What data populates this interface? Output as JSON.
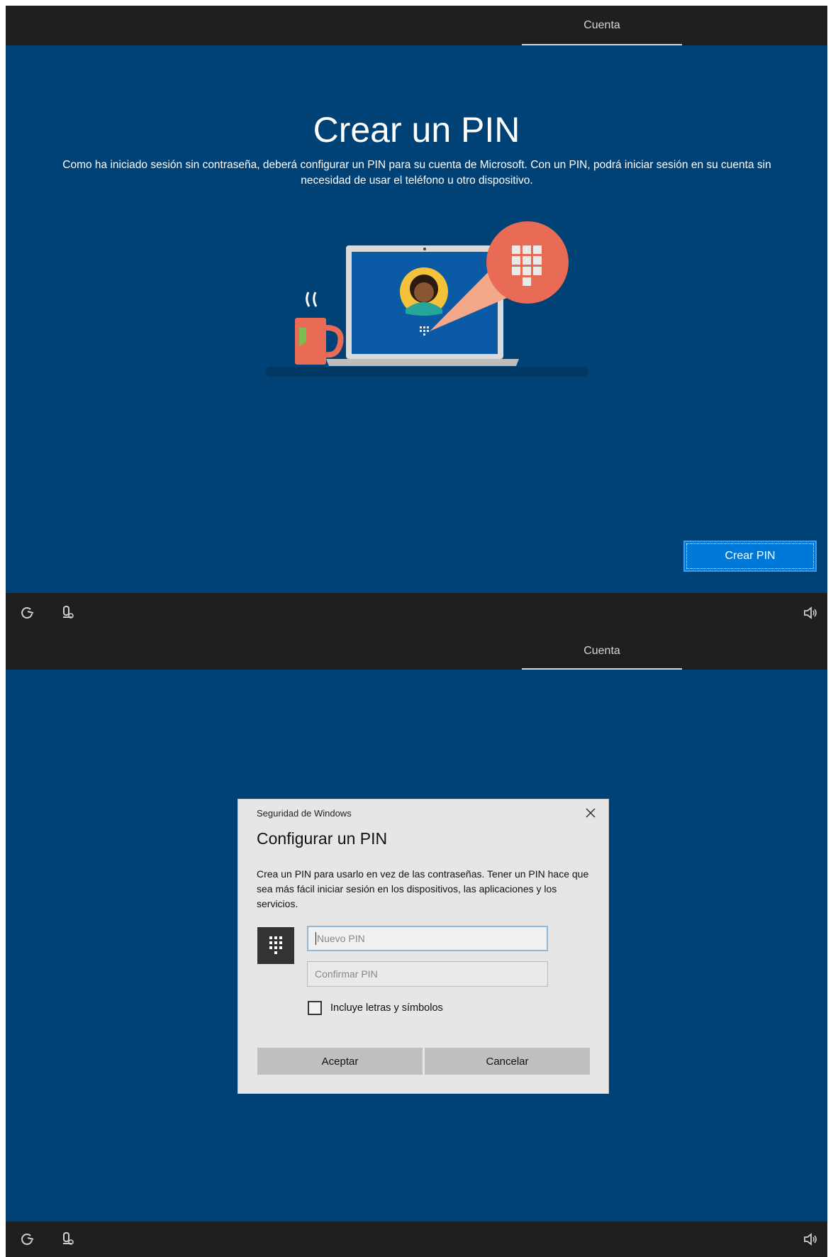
{
  "topbar": {
    "tab_label": "Cuenta"
  },
  "screen1": {
    "title": "Crear un PIN",
    "description": "Como ha iniciado sesión sin contraseña, deberá configurar un PIN para su cuenta de Microsoft. Con un PIN, podrá iniciar sesión en su cuenta sin necesidad de usar el teléfono u otro dispositivo.",
    "button_label": "Crear PIN"
  },
  "dialog": {
    "caption": "Seguridad de Windows",
    "title": "Configurar un PIN",
    "text": "Crea un PIN para usarlo en vez de las contraseñas. Tener un PIN hace que sea más fácil iniciar sesión en los dispositivos, las aplicaciones y los servicios.",
    "new_pin_placeholder": "Nuevo PIN",
    "confirm_pin_placeholder": "Confirmar PIN",
    "checkbox_label": "Incluye letras y símbolos",
    "accept_label": "Aceptar",
    "cancel_label": "Cancelar"
  },
  "icons": {
    "ease_of_access": "ease-of-access-icon",
    "microphone": "microphone-icon",
    "volume": "volume-icon",
    "close": "close-icon",
    "keypad": "keypad-icon"
  },
  "colors": {
    "background": "#004275",
    "bars": "#1f1f1f",
    "accent_button": "#0078d7",
    "dialog": "#e6e6e6"
  }
}
